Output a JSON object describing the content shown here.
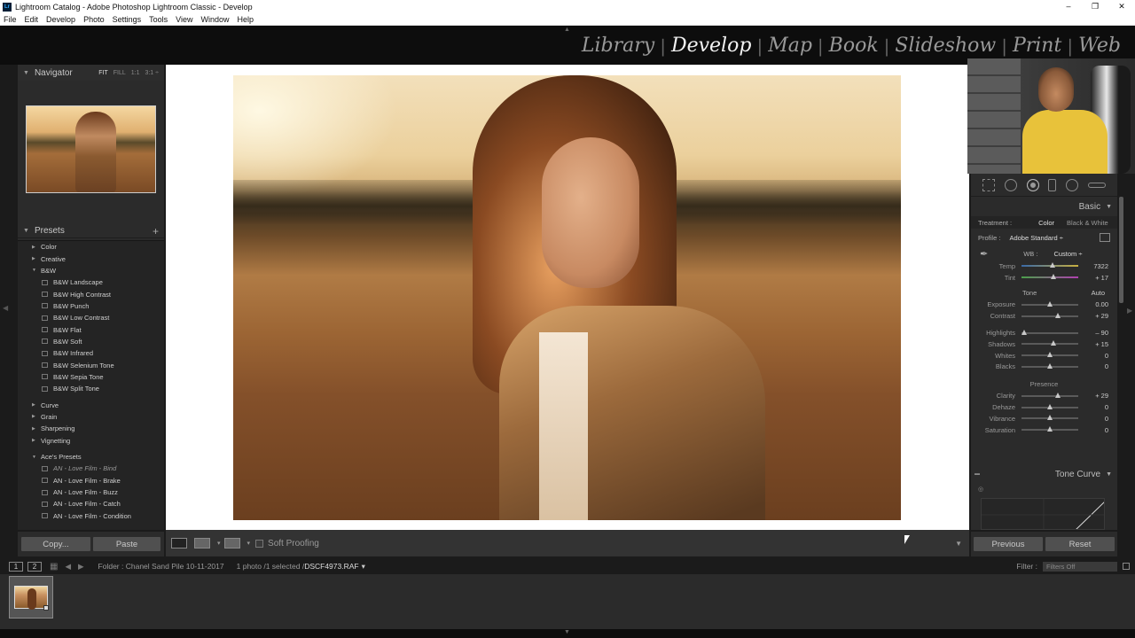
{
  "window": {
    "app_icon": "Lr",
    "title": "Lightroom Catalog - Adobe Photoshop Lightroom Classic - Develop",
    "controls": [
      "–",
      "❐",
      "✕"
    ]
  },
  "menu": [
    "File",
    "Edit",
    "Develop",
    "Photo",
    "Settings",
    "Tools",
    "View",
    "Window",
    "Help"
  ],
  "modules": {
    "items": [
      "Library",
      "Develop",
      "Map",
      "Book",
      "Slideshow",
      "Print",
      "Web"
    ],
    "active": "Develop",
    "separator": "|"
  },
  "navigator": {
    "title": "Navigator",
    "options": [
      "FIT",
      "FILL",
      "1:1",
      "3:1 ÷"
    ]
  },
  "presets": {
    "title": "Presets",
    "add": "+",
    "items": [
      {
        "kind": "folder",
        "label": "Color",
        "open": false
      },
      {
        "kind": "folder",
        "label": "Creative",
        "open": false
      },
      {
        "kind": "folder",
        "label": "B&W",
        "open": true
      },
      {
        "kind": "preset",
        "label": "B&W Landscape"
      },
      {
        "kind": "preset",
        "label": "B&W High Contrast"
      },
      {
        "kind": "preset",
        "label": "B&W Punch"
      },
      {
        "kind": "preset",
        "label": "B&W Low Contrast"
      },
      {
        "kind": "preset",
        "label": "B&W Flat"
      },
      {
        "kind": "preset",
        "label": "B&W Soft"
      },
      {
        "kind": "preset",
        "label": "B&W Infrared"
      },
      {
        "kind": "preset",
        "label": "B&W Selenium Tone"
      },
      {
        "kind": "preset",
        "label": "B&W Sepia Tone"
      },
      {
        "kind": "preset",
        "label": "B&W Split Tone"
      },
      {
        "kind": "gap"
      },
      {
        "kind": "folder",
        "label": "Curve",
        "open": false
      },
      {
        "kind": "folder",
        "label": "Grain",
        "open": false
      },
      {
        "kind": "folder",
        "label": "Sharpening",
        "open": false
      },
      {
        "kind": "folder",
        "label": "Vignetting",
        "open": false
      },
      {
        "kind": "gap"
      },
      {
        "kind": "folder",
        "label": "Ace's Presets",
        "open": true
      },
      {
        "kind": "preset",
        "label": "AN - Love Film - Bind",
        "dim": true
      },
      {
        "kind": "preset",
        "label": "AN - Love Film - Brake"
      },
      {
        "kind": "preset",
        "label": "AN - Love Film - Buzz"
      },
      {
        "kind": "preset",
        "label": "AN - Love Film - Catch"
      },
      {
        "kind": "preset",
        "label": "AN - Love Film - Condition"
      }
    ]
  },
  "left_buttons": {
    "copy": "Copy...",
    "paste": "Paste"
  },
  "toolbar": {
    "soft_proofing": "Soft Proofing",
    "view_yy": "Y|Y",
    "view_rr": "R|R"
  },
  "basic": {
    "title": "Basic",
    "treatment_label": "Treatment :",
    "treatment_options": [
      "Color",
      "Black & White"
    ],
    "treatment_active": "Color",
    "profile_label": "Profile :",
    "profile_value": "Adobe Standard ÷",
    "wb_label": "WB :",
    "wb_value": "Custom ÷",
    "tone_label": "Tone",
    "auto": "Auto",
    "presence_label": "Presence",
    "sliders": [
      {
        "label": "Temp",
        "value": "7322",
        "pos": 0.55,
        "group": "wb"
      },
      {
        "label": "Tint",
        "value": "+ 17",
        "pos": 0.57,
        "group": "wb"
      },
      {
        "label": "Exposure",
        "value": "0.00",
        "pos": 0.5,
        "group": "tone"
      },
      {
        "label": "Contrast",
        "value": "+ 29",
        "pos": 0.64,
        "group": "tone"
      },
      {
        "label": "Highlights",
        "value": "– 90",
        "pos": 0.05,
        "group": "tone2"
      },
      {
        "label": "Shadows",
        "value": "+ 15",
        "pos": 0.57,
        "group": "tone2"
      },
      {
        "label": "Whites",
        "value": "0",
        "pos": 0.5,
        "group": "tone2"
      },
      {
        "label": "Blacks",
        "value": "0",
        "pos": 0.5,
        "group": "tone2"
      },
      {
        "label": "Clarity",
        "value": "+ 29",
        "pos": 0.64,
        "group": "presence"
      },
      {
        "label": "Dehaze",
        "value": "0",
        "pos": 0.5,
        "group": "presence"
      },
      {
        "label": "Vibrance",
        "value": "0",
        "pos": 0.5,
        "group": "presence"
      },
      {
        "label": "Saturation",
        "value": "0",
        "pos": 0.5,
        "group": "presence"
      }
    ]
  },
  "tone_curve": {
    "title": "Tone Curve"
  },
  "right_buttons": {
    "previous": "Previous",
    "reset": "Reset"
  },
  "filmstrip": {
    "page1": "1",
    "page2": "2",
    "folder": "Folder : Chanel Sand Pile 10-11-2017",
    "selection": "1 photo /1 selected /",
    "filename": "DSCF4973.RAF",
    "filename_dd": "▾",
    "filter_label": "Filter :",
    "filter_value": "Filters Off"
  }
}
